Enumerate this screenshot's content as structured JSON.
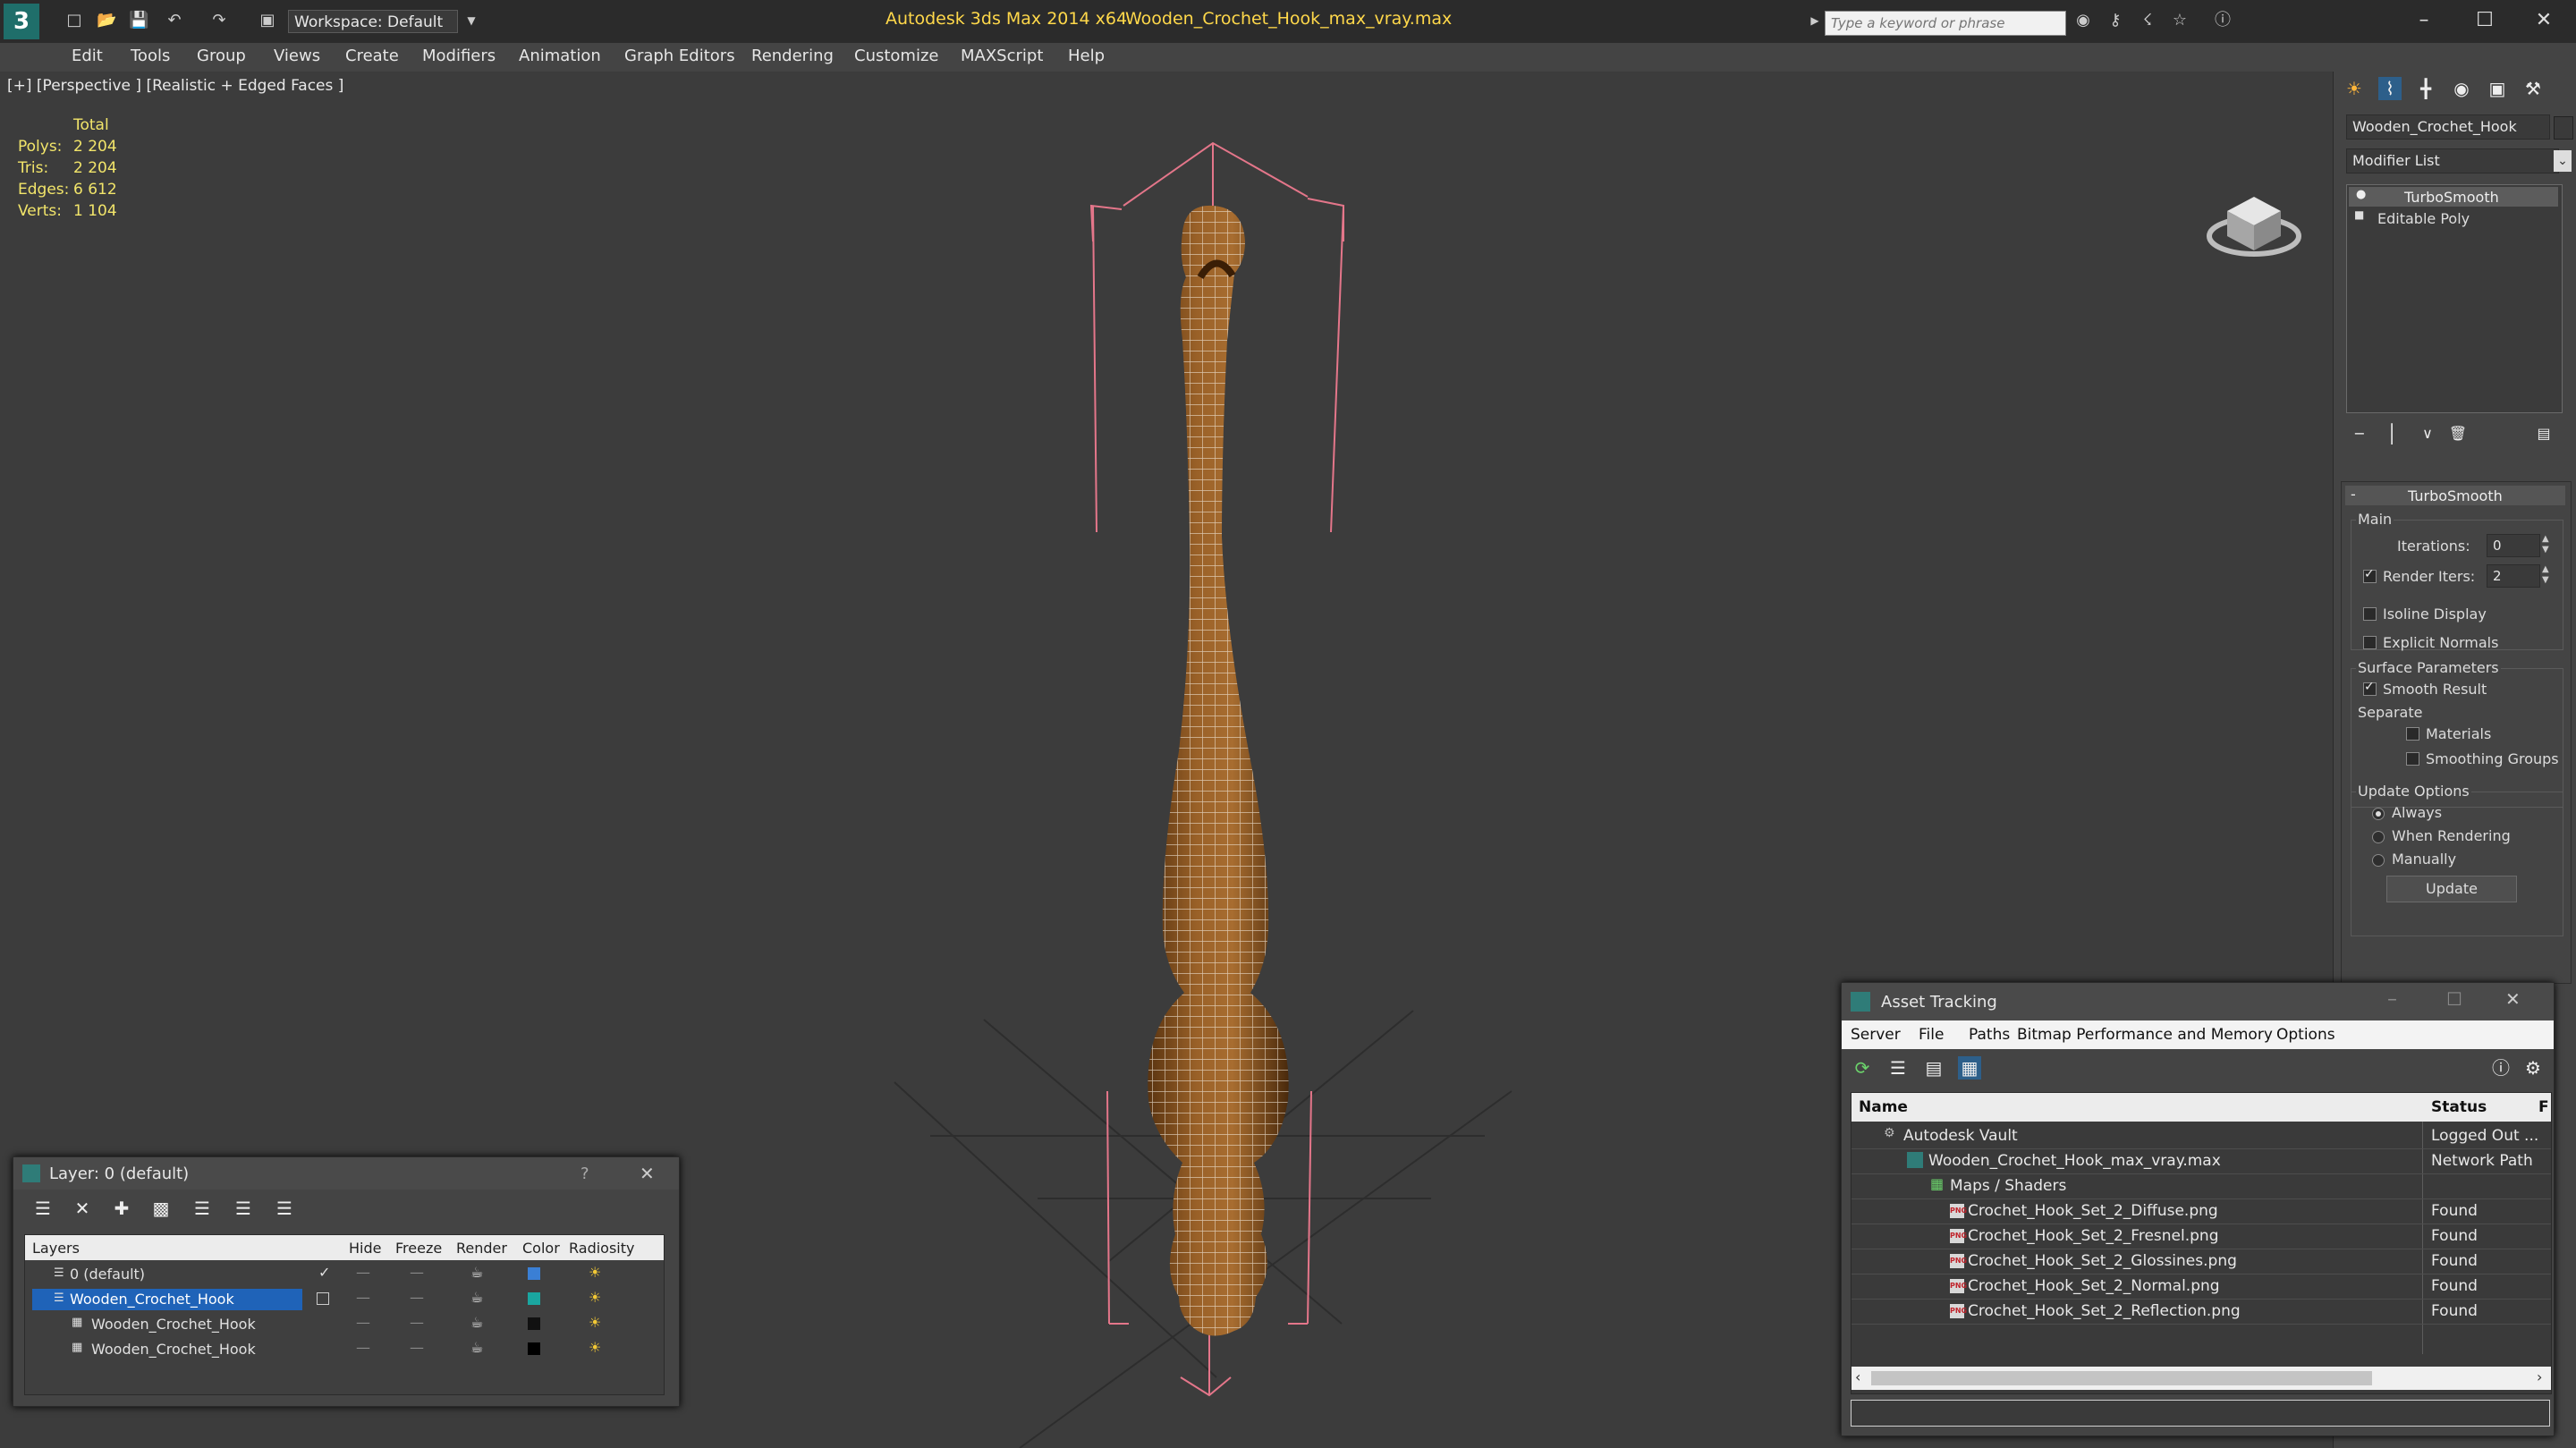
{
  "titlebar": {
    "app_title": "Autodesk 3ds Max  2014 x64",
    "file_name": "Wooden_Crochet_Hook_max_vray.max",
    "workspace": "Workspace: Default",
    "search_placeholder": "Type a keyword or phrase"
  },
  "menu": [
    "Edit",
    "Tools",
    "Group",
    "Views",
    "Create",
    "Modifiers",
    "Animation",
    "Graph Editors",
    "Rendering",
    "Customize",
    "MAXScript",
    "Help"
  ],
  "viewport": {
    "label": "[+] [Perspective ] [Realistic + Edged Faces ]",
    "stats": {
      "header": "Total",
      "rows": [
        {
          "k": "Polys:",
          "v": "2 204"
        },
        {
          "k": "Tris:",
          "v": "2 204"
        },
        {
          "k": "Edges:",
          "v": "6 612"
        },
        {
          "k": "Verts:",
          "v": "1 104"
        }
      ]
    }
  },
  "command_panel": {
    "object_name": "Wooden_Crochet_Hook",
    "modifier_list": "Modifier List",
    "stack": [
      "TurboSmooth",
      "Editable Poly"
    ],
    "rollout_title": "TurboSmooth",
    "main_label": "Main",
    "iterations_label": "Iterations:",
    "iterations_value": "0",
    "render_iters_label": "Render Iters:",
    "render_iters_value": "2",
    "isoline": "Isoline Display",
    "explicit_normals": "Explicit Normals",
    "surface_params": "Surface Parameters",
    "smooth_result": "Smooth Result",
    "separate": "Separate",
    "materials": "Materials",
    "smoothing_groups": "Smoothing Groups",
    "update_options": "Update Options",
    "always": "Always",
    "when_rendering": "When Rendering",
    "manually": "Manually",
    "update_button": "Update"
  },
  "layer_dialog": {
    "title": "Layer: 0 (default)",
    "help": "?",
    "columns": [
      "Layers",
      "Hide",
      "Freeze",
      "Render",
      "Color",
      "Radiosity"
    ],
    "rows": [
      {
        "name": "0 (default)",
        "color": "#3a7fd5"
      },
      {
        "name": "Wooden_Crochet_Hook",
        "color": "#1aa6a0"
      },
      {
        "name": "Wooden_Crochet_Hook",
        "color": "#111111"
      },
      {
        "name": "Wooden_Crochet_Hook",
        "color": "#000000"
      }
    ]
  },
  "asset_tracking": {
    "title": "Asset Tracking",
    "menu": [
      "Server",
      "File",
      "Paths",
      "Bitmap Performance and Memory",
      "Options"
    ],
    "col_name": "Name",
    "col_status": "Status",
    "col_extra": "F",
    "rows": [
      {
        "name": "Autodesk Vault",
        "status": "Logged Out ..."
      },
      {
        "name": "Wooden_Crochet_Hook_max_vray.max",
        "status": "Network Path"
      },
      {
        "name": "Maps / Shaders",
        "status": ""
      },
      {
        "name": "Crochet_Hook_Set_2_Diffuse.png",
        "status": "Found"
      },
      {
        "name": "Crochet_Hook_Set_2_Fresnel.png",
        "status": "Found"
      },
      {
        "name": "Crochet_Hook_Set_2_Glossines.png",
        "status": "Found"
      },
      {
        "name": "Crochet_Hook_Set_2_Normal.png",
        "status": "Found"
      },
      {
        "name": "Crochet_Hook_Set_2_Reflection.png",
        "status": "Found"
      }
    ]
  }
}
